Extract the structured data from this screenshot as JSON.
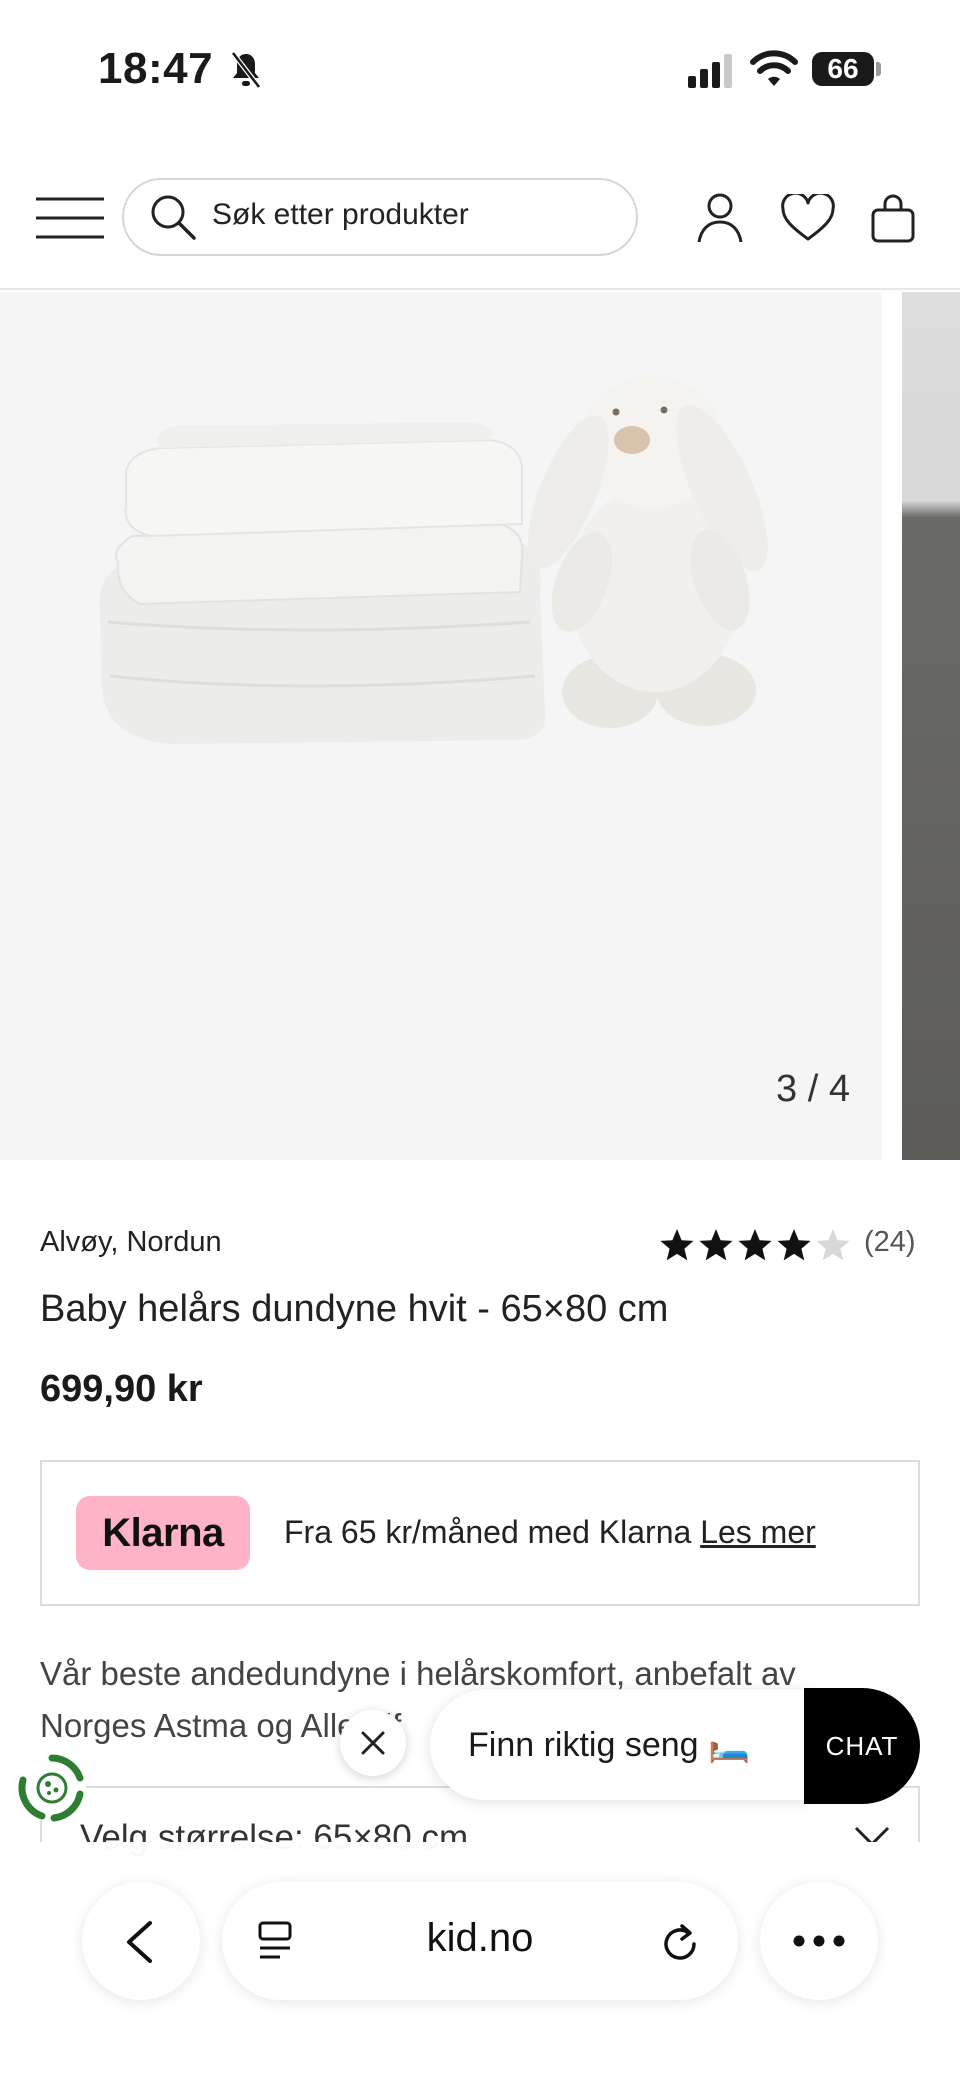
{
  "status_bar": {
    "time": "18:47",
    "battery": "66"
  },
  "header": {
    "search_placeholder": "Søk etter produkter"
  },
  "gallery": {
    "counter": "3 / 4"
  },
  "product": {
    "brand": "Alvøy, Nordun",
    "rating_stars": 4,
    "rating_max": 5,
    "review_count": "(24)",
    "title": "Baby helårs dundyne hvit - 65×80 cm",
    "price": "699,90 kr",
    "description_line1": "Vår beste andedundyne i helårskomfort, anbefalt av",
    "description_line2": "Norges Astma og Allergif"
  },
  "klarna": {
    "logo": "Klarna",
    "text": "Fra 65 kr/måned med Klarna",
    "link": "Les mer"
  },
  "size_selector": {
    "label": "Velg størrelse: 65×80 cm"
  },
  "promo": {
    "text": "Finn riktig seng 🛏️"
  },
  "chat": {
    "label": "CHAT"
  },
  "browser": {
    "url": "kid.no"
  },
  "colors": {
    "klarna_pink": "#ffb3c7",
    "chat_black": "#000000",
    "cookie_green": "#2e7d32"
  }
}
